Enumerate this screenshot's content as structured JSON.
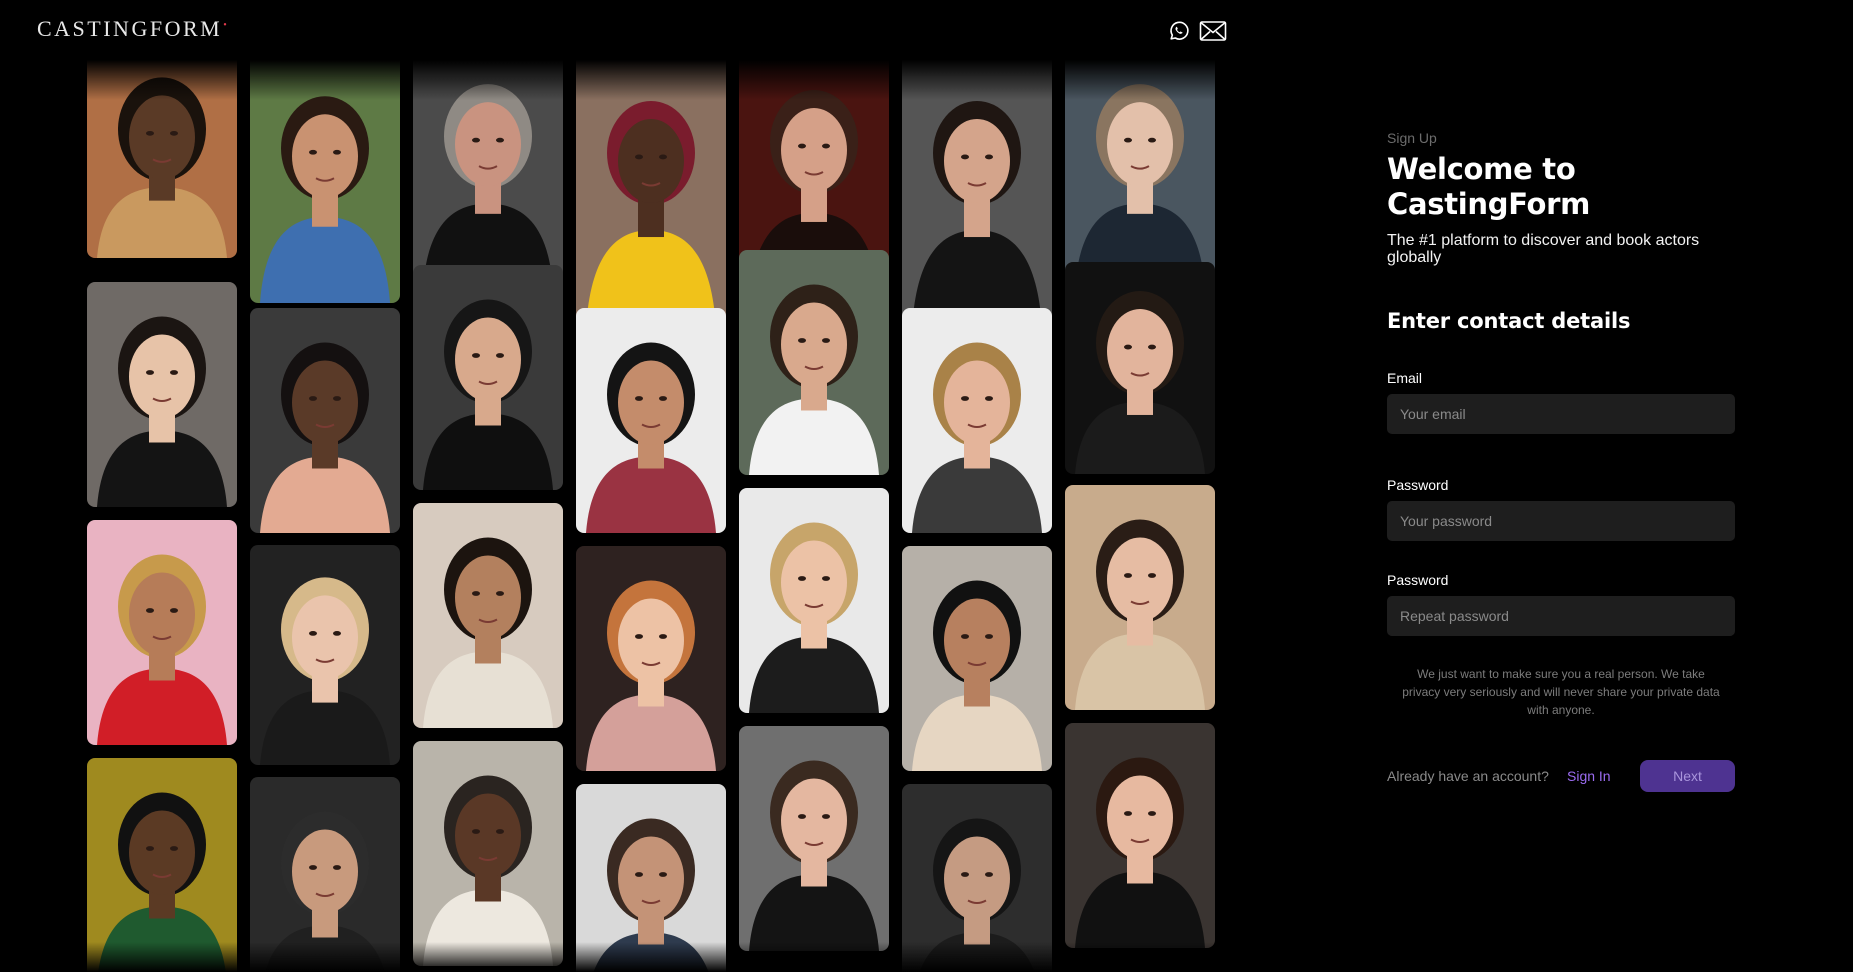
{
  "header": {
    "logo": "CASTINGFORM",
    "logo_mark": "•",
    "icons": [
      "whatsapp-icon",
      "mail-icon"
    ]
  },
  "gallery": {
    "columns": [
      [
        {
          "bg": "#b06f45",
          "skin": "#5a3a26",
          "hair": "#1a120c",
          "shirt": "#c9995f"
        },
        {
          "bg": "#6f6a66",
          "skin": "#e7c3a8",
          "hair": "#1b1512",
          "shirt": "#141414"
        },
        {
          "bg": "#e9b3c2",
          "skin": "#b67c58",
          "hair": "#c79a4b",
          "shirt": "#d11e27"
        },
        {
          "bg": "#9f8a1f",
          "skin": "#5b3a24",
          "hair": "#111",
          "shirt": "#1f5a2f"
        }
      ],
      [
        {
          "bg": "#5e7a45",
          "skin": "#c99271",
          "hair": "#2a1a12",
          "shirt": "#3e6fb0"
        },
        {
          "bg": "#3a3a3a",
          "skin": "#5a3a28",
          "hair": "#141010",
          "shirt": "#e3aa92"
        },
        {
          "bg": "#222",
          "skin": "#eac4ac",
          "hair": "#d6b98a",
          "shirt": "#1a1a1a"
        },
        {
          "bg": "#2a2a2a",
          "skin": "#c89a7d",
          "hair": "#2c2c2c",
          "shirt": "#202020"
        }
      ],
      [
        {
          "bg": "#4b4b4b",
          "skin": "#c99380",
          "hair": "#8f8a84",
          "shirt": "#111"
        },
        {
          "bg": "#3a3a3a",
          "skin": "#d8a98c",
          "hair": "#161616",
          "shirt": "#0f0f0f"
        },
        {
          "bg": "#d7cbbf",
          "skin": "#b3805e",
          "hair": "#1c140f",
          "shirt": "#e7e0d4"
        },
        {
          "bg": "#b9b4aa",
          "skin": "#5a3826",
          "hair": "#2a2420",
          "shirt": "#ede8df"
        }
      ],
      [
        {
          "bg": "#8a7060",
          "skin": "#4d2f20",
          "hair": "#7a1c2d",
          "shirt": "#f0c21a"
        },
        {
          "bg": "#ececec",
          "skin": "#c48c6b",
          "hair": "#141414",
          "shirt": "#9a3342"
        },
        {
          "bg": "#2e2220",
          "skin": "#edc2a5",
          "hair": "#c4743c",
          "shirt": "#d4a09a"
        },
        {
          "bg": "#d9d9d9",
          "skin": "#c49377",
          "hair": "#3a2a22",
          "shirt": "#2e3b4e"
        }
      ],
      [
        {
          "bg": "#4a1410",
          "skin": "#d5a088",
          "hair": "#3a2018",
          "shirt": "#1a0d0b"
        },
        {
          "bg": "#5d6a5a",
          "skin": "#d9a98d",
          "hair": "#2e2118",
          "shirt": "#f2f2f2"
        },
        {
          "bg": "#e9e9e9",
          "skin": "#ecc2a6",
          "hair": "#c7a56a",
          "shirt": "#1c1c1c"
        },
        {
          "bg": "#6f6f6f",
          "skin": "#e4b7a0",
          "hair": "#3a2a20",
          "shirt": "#141414"
        }
      ],
      [
        {
          "bg": "#555",
          "skin": "#d4a48b",
          "hair": "#1f1612",
          "shirt": "#141414"
        },
        {
          "bg": "#ececec",
          "skin": "#e4b49a",
          "hair": "#a98248",
          "shirt": "#3a3a3a"
        },
        {
          "bg": "#b6b0a8",
          "skin": "#b7805f",
          "hair": "#111",
          "shirt": "#e6d6c2"
        },
        {
          "bg": "#2d2d2d",
          "skin": "#c59b82",
          "hair": "#151515",
          "shirt": "#1c1c1c"
        }
      ],
      [
        {
          "bg": "#4a5660",
          "skin": "#e3c0aa",
          "hair": "#8a7560",
          "shirt": "#1d2733"
        },
        {
          "bg": "#111",
          "skin": "#e2b49c",
          "hair": "#231a14",
          "shirt": "#1b1b1b"
        },
        {
          "bg": "#c8ab8c",
          "skin": "#e6bca3",
          "hair": "#2a1d16",
          "shirt": "#d9c4a6"
        },
        {
          "bg": "#3a3431",
          "skin": "#e7b9a0",
          "hair": "#2b1911",
          "shirt": "#111"
        }
      ]
    ]
  },
  "form": {
    "step_label": "Sign Up",
    "title_line1": "Welcome to",
    "title_line2": "CastingForm",
    "subtitle": "The #1 platform to discover and book actors globally",
    "section_title": "Enter contact details",
    "email": {
      "label": "Email",
      "placeholder": "Your email",
      "value": ""
    },
    "password": {
      "label": "Password",
      "placeholder": "Your password",
      "value": ""
    },
    "repeat_password": {
      "label": "Password",
      "placeholder": "Repeat password",
      "value": ""
    },
    "notice": "We just want to make sure you a real person. We take privacy very seriously and will never share your private data with anyone.",
    "have_account": "Already have an account?",
    "signin_label": "Sign In",
    "next_label": "Next",
    "accent_color": "#4e3391",
    "link_color": "#9b6cf0"
  }
}
